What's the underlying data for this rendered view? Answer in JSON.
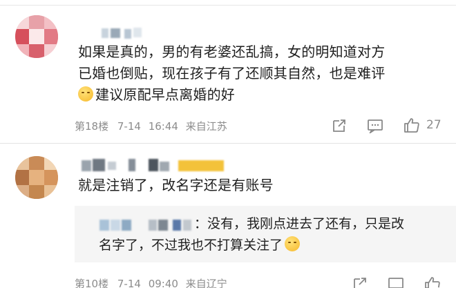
{
  "comments": [
    {
      "text_line1": "如果是真的，男的有老婆还乱搞，女的明知道对方",
      "text_line2": "已婚也倒贴，现在孩子有了还顺其自然，也是难评",
      "text_line3": "建议原配早点离婚的好",
      "emoji": "shush-emoji",
      "floor": "第18楼",
      "date": "7-14",
      "time": "16:44",
      "location": "来自江苏",
      "likes": "27"
    },
    {
      "text": "就是注销了，改名字还是有账号",
      "floor": "第10楼",
      "date": "7-14",
      "time": "09:40",
      "location": "来自辽宁",
      "reply": {
        "line1": "：没有，我刚点进去了还有，只是改",
        "line2": "名字了，不过我也不打算关注了"
      }
    }
  ],
  "colors": {
    "meta": "#8c8c8c",
    "reply_bg": "#f5f5f5"
  }
}
